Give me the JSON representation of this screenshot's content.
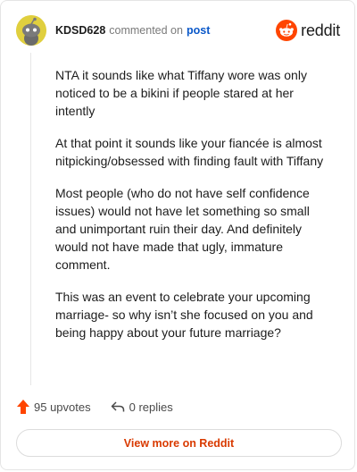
{
  "comment": {
    "author": "KDSD628",
    "action_text": "commented on",
    "post_link_text": "post",
    "paragraphs": [
      "NTA it sounds like what Tiffany wore was only noticed to be a bikini if people stared at her intently",
      "At that point it sounds like your fiancée is almost nitpicking/obsessed with finding fault with Tiffany",
      "Most people (who do not have self confidence issues) would not have let something so small and unimportant ruin their day. And definitely would not have made that ugly, immature comment.",
      "This was an event to celebrate your upcoming marriage- so why isn’t she focused on you and being happy about your future marriage?"
    ],
    "upvotes_text": "95 upvotes",
    "replies_text": "0 replies"
  },
  "brand": {
    "name": "reddit",
    "icon": "reddit-snoo-icon",
    "color": "#ff4500"
  },
  "cta": {
    "label": "View more on Reddit"
  },
  "colors": {
    "accent": "#d93a00",
    "link": "#0a58c9",
    "upvote": "#ff4500",
    "avatar_bg": "#e0cf3e"
  }
}
